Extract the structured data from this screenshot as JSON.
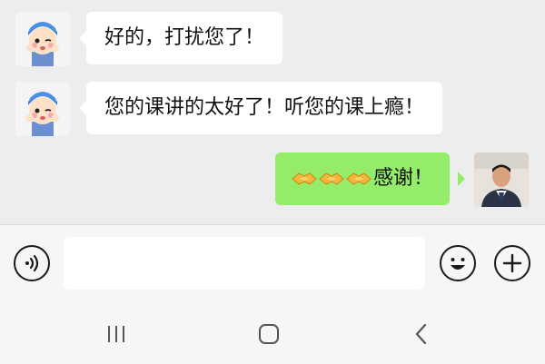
{
  "messages": [
    {
      "side": "in",
      "text": "好的，打扰您了！",
      "avatar": "cartoon-boy-avatar"
    },
    {
      "side": "in",
      "text": "您的课讲的太好了！听您的课上瘾！",
      "avatar": "cartoon-boy-avatar"
    },
    {
      "side": "out",
      "emoji": [
        "handshake",
        "handshake",
        "handshake"
      ],
      "text": "感谢！",
      "avatar": "man-photo-avatar"
    }
  ],
  "input_bar": {
    "value": "",
    "icons": [
      "voice-icon",
      "emoji-icon",
      "plus-icon"
    ]
  },
  "nav_bar": {
    "icons": [
      "recent-apps-icon",
      "home-icon",
      "back-icon"
    ]
  },
  "colors": {
    "chat_background": "#ededed",
    "incoming_bubble": "#ffffff",
    "outgoing_bubble": "#95ec69",
    "input_bar": "#f6f6f6"
  }
}
